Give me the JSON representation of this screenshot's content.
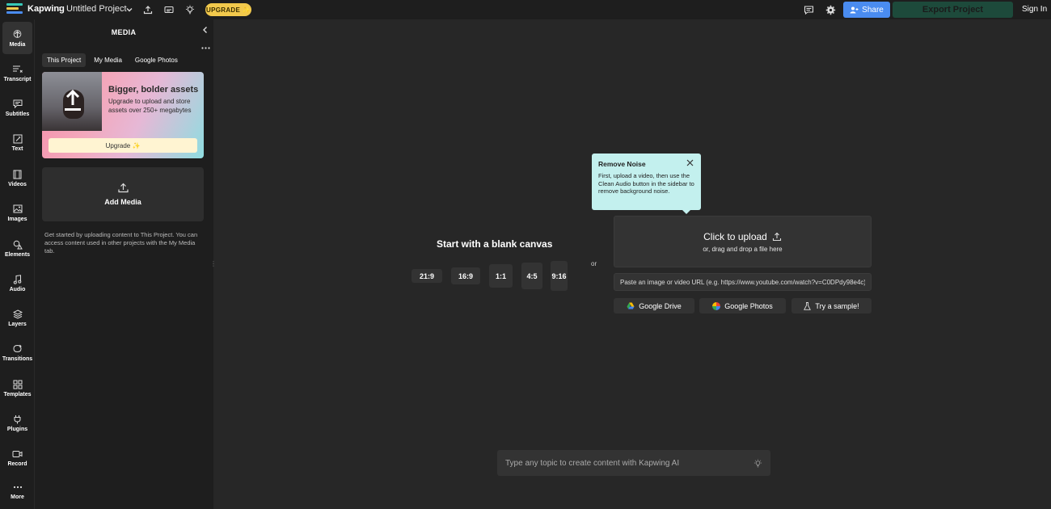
{
  "topbar": {
    "brand": "Kapwing",
    "brand_separator": "›",
    "project_title": "Untitled Project",
    "upgrade_label": "UPGRADE ✨",
    "share_label": "Share",
    "export_label": "Export Project",
    "signin_label": "Sign In"
  },
  "rail": {
    "items": [
      {
        "label": "Media",
        "icon": "upload-icon"
      },
      {
        "label": "Transcript",
        "icon": "transcript-icon"
      },
      {
        "label": "Subtitles",
        "icon": "subtitles-icon"
      },
      {
        "label": "Text",
        "icon": "text-icon"
      },
      {
        "label": "Videos",
        "icon": "video-icon"
      },
      {
        "label": "Images",
        "icon": "image-icon"
      },
      {
        "label": "Elements",
        "icon": "shapes-icon"
      },
      {
        "label": "Audio",
        "icon": "music-icon"
      },
      {
        "label": "Layers",
        "icon": "layers-icon"
      },
      {
        "label": "Transitions",
        "icon": "transition-icon"
      },
      {
        "label": "Templates",
        "icon": "grid-icon"
      },
      {
        "label": "Plugins",
        "icon": "plug-icon"
      },
      {
        "label": "Record",
        "icon": "camera-icon"
      },
      {
        "label": "More",
        "icon": "ellipsis-icon"
      }
    ]
  },
  "panel": {
    "title": "MEDIA",
    "tabs": [
      "This Project",
      "My Media",
      "Google Photos"
    ],
    "active_tab": "This Project",
    "promo": {
      "title": "Bigger, bolder assets",
      "text": "Upgrade to upload and store assets over 250+ megabytes",
      "button": "Upgrade ✨"
    },
    "add_media_label": "Add Media",
    "help_text": "Get started by uploading content to This Project. You can access content used in other projects with the My Media tab."
  },
  "canvas": {
    "blank_title": "Start with a blank canvas",
    "ratios": [
      "21:9",
      "16:9",
      "1:1",
      "4:5",
      "9:16"
    ],
    "or_label": "or"
  },
  "tooltip": {
    "title": "Remove Noise",
    "text": "First, upload a video, then use the Clean Audio button in the sidebar to remove background noise."
  },
  "upload": {
    "title": "Click to upload",
    "subtitle": "or, drag and drop a file here",
    "url_placeholder": "Paste an image or video URL (e.g. https://www.youtube.com/watch?v=C0DPdy98e4c)",
    "sources": [
      {
        "label": "Google Drive",
        "icon": "google-drive-icon"
      },
      {
        "label": "Google Photos",
        "icon": "google-photos-icon"
      },
      {
        "label": "Try a sample!",
        "icon": "flask-icon"
      }
    ]
  },
  "ai": {
    "placeholder": "Type any topic to create content with Kapwing AI"
  },
  "colors": {
    "accent_blue": "#4a8cf0",
    "export_green": "#1d4a3b",
    "upgrade_yellow": "#f2c94c",
    "tooltip_bg": "#c3f0ee"
  }
}
